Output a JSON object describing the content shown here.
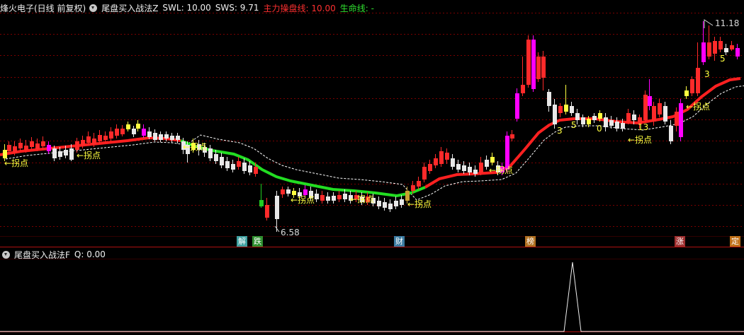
{
  "header": {
    "stock_name": "烽火电子(日线 前复权)",
    "indicator": "尾盘买入战法Z",
    "swl": "SWL: 10.00",
    "sws": "SWS: 9.71",
    "main_line": "主力操盘线: 10.00",
    "life_line": "生命线: -"
  },
  "sub_header": {
    "indicator": "尾盘买入战法F",
    "q": "Q: 0.00"
  },
  "annotations": {
    "turn_label": "←拐点",
    "high_price": "11.18",
    "low_price": "6.58",
    "num_3a": "3",
    "num_5a": "5",
    "num_0": "0",
    "num_13": "13",
    "num_3b": "3",
    "num_5b": "5"
  },
  "event_tags": [
    {
      "text": "解",
      "color": "#3fa0a0"
    },
    {
      "text": "跌",
      "color": "#2f8f2f"
    },
    {
      "text": "财",
      "color": "#3a7aa0"
    },
    {
      "text": "榜",
      "color": "#b07020"
    },
    {
      "text": "涨",
      "color": "#a03030"
    },
    {
      "text": "定",
      "color": "#c07018"
    }
  ],
  "colors": {
    "background": "#000000",
    "up": "#ff2a2a",
    "down": "#e8e8e8",
    "strong": "#ff00ff",
    "main_line_up": "#ff2020",
    "main_line_down": "#22dd22",
    "life_line": "#ffffff",
    "label": "#ffff40",
    "divider": "#b01010",
    "grid": "#7a0000"
  },
  "chart_data": {
    "type": "candlestick",
    "price_range": [
      6.3,
      11.4
    ],
    "high": 11.18,
    "low": 6.58,
    "main_line_value": 10.0,
    "sub_indicator": {
      "name": "Q",
      "value": 0.0
    }
  }
}
